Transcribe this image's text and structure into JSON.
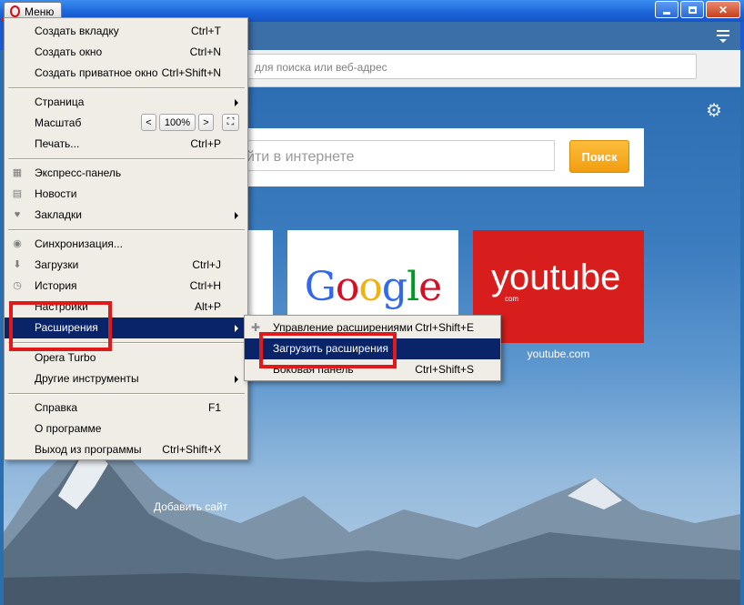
{
  "window": {
    "menu_label": "Меню"
  },
  "toolbar": {
    "address_placeholder": "для поиска или веб-адрес"
  },
  "speed_dial": {
    "search_placeholder": "йти в интернете",
    "search_button": "Поиск",
    "tiles": [
      {
        "name": "google",
        "logo": "Google",
        "caption": ""
      },
      {
        "name": "youtube",
        "logo": "youtube",
        "logo_sub": "com",
        "caption": "youtube.com"
      }
    ],
    "add_site": "Добавить сайт"
  },
  "main_menu": {
    "new_tab": {
      "label": "Создать вкладку",
      "shortcut": "Ctrl+T"
    },
    "new_window": {
      "label": "Создать окно",
      "shortcut": "Ctrl+N"
    },
    "private_window": {
      "label": "Создать приватное окно",
      "shortcut": "Ctrl+Shift+N"
    },
    "page": {
      "label": "Страница"
    },
    "zoom": {
      "label": "Масштаб",
      "value": "100%",
      "dec": "<",
      "inc": ">",
      "full": "⛶"
    },
    "print": {
      "label": "Печать...",
      "shortcut": "Ctrl+P"
    },
    "speed_dial": {
      "label": "Экспресс-панель"
    },
    "news": {
      "label": "Новости"
    },
    "bookmarks": {
      "label": "Закладки"
    },
    "sync": {
      "label": "Синхронизация..."
    },
    "downloads": {
      "label": "Загрузки",
      "shortcut": "Ctrl+J"
    },
    "history": {
      "label": "История",
      "shortcut": "Ctrl+H"
    },
    "settings": {
      "label": "Настройки",
      "shortcut": "Alt+P"
    },
    "extensions": {
      "label": "Расширения"
    },
    "turbo": {
      "label": "Opera Turbo"
    },
    "other_tools": {
      "label": "Другие инструменты"
    },
    "help": {
      "label": "Справка",
      "shortcut": "F1"
    },
    "about": {
      "label": "О программе"
    },
    "exit": {
      "label": "Выход из программы",
      "shortcut": "Ctrl+Shift+X"
    }
  },
  "extensions_submenu": {
    "manage": {
      "label": "Управление расширениями",
      "shortcut": "Ctrl+Shift+E"
    },
    "download": {
      "label": "Загрузить расширения"
    },
    "sidebar": {
      "label": "Боковая панель",
      "shortcut": "Ctrl+Shift+S"
    }
  },
  "colors": {
    "highlight": "#0a246a",
    "annotation": "#e01a1a",
    "search_button": "#f5a623",
    "youtube_tile": "#d81d1d"
  }
}
